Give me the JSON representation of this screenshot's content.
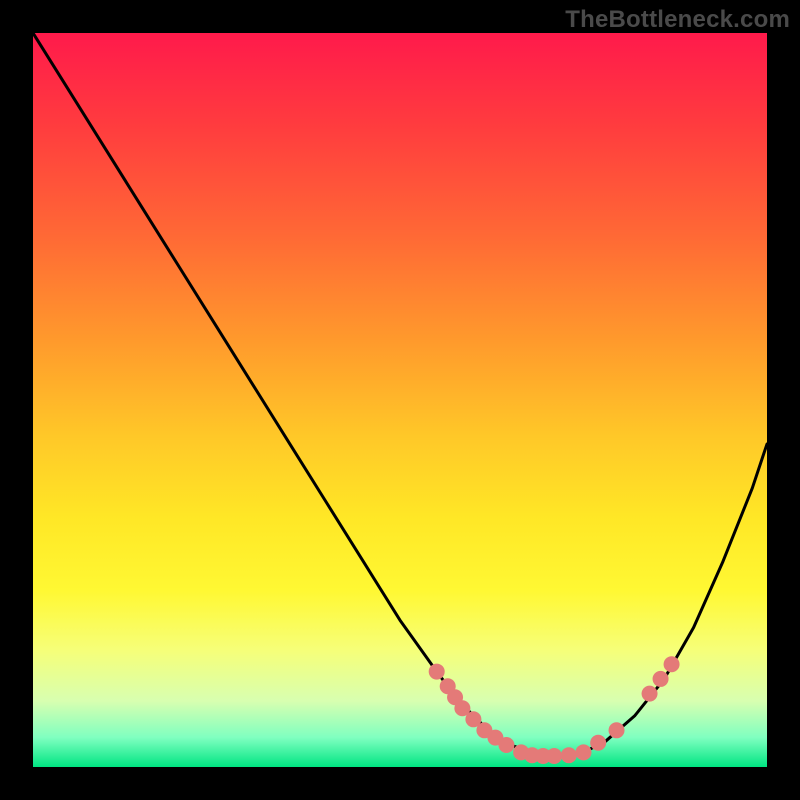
{
  "watermark": "TheBottleneck.com",
  "colors": {
    "background": "#000000",
    "marker": "#e47a78",
    "curve": "#000000"
  },
  "chart_data": {
    "type": "line",
    "title": "",
    "xlabel": "",
    "ylabel": "",
    "xlim": [
      0,
      100
    ],
    "ylim": [
      0,
      100
    ],
    "grid": false,
    "series": [
      {
        "name": "curve",
        "x": [
          0,
          5,
          10,
          15,
          20,
          25,
          30,
          35,
          40,
          45,
          50,
          55,
          58,
          60,
          62,
          65,
          68,
          70,
          72,
          75,
          78,
          82,
          86,
          90,
          94,
          98,
          100
        ],
        "y": [
          100,
          92,
          84,
          76,
          68,
          60,
          52,
          44,
          36,
          28,
          20,
          13,
          9,
          7,
          5,
          3,
          2,
          1.5,
          1.5,
          2,
          3.5,
          7,
          12,
          19,
          28,
          38,
          44
        ]
      }
    ],
    "markers": [
      {
        "x": 55.0,
        "y": 13.0
      },
      {
        "x": 56.5,
        "y": 11.0
      },
      {
        "x": 57.5,
        "y": 9.5
      },
      {
        "x": 58.5,
        "y": 8.0
      },
      {
        "x": 60.0,
        "y": 6.5
      },
      {
        "x": 61.5,
        "y": 5.0
      },
      {
        "x": 63.0,
        "y": 4.0
      },
      {
        "x": 64.5,
        "y": 3.0
      },
      {
        "x": 66.5,
        "y": 2.0
      },
      {
        "x": 68.0,
        "y": 1.6
      },
      {
        "x": 69.5,
        "y": 1.5
      },
      {
        "x": 71.0,
        "y": 1.5
      },
      {
        "x": 73.0,
        "y": 1.6
      },
      {
        "x": 75.0,
        "y": 2.0
      },
      {
        "x": 77.0,
        "y": 3.3
      },
      {
        "x": 79.5,
        "y": 5.0
      },
      {
        "x": 84.0,
        "y": 10.0
      },
      {
        "x": 85.5,
        "y": 12.0
      },
      {
        "x": 87.0,
        "y": 14.0
      }
    ]
  }
}
